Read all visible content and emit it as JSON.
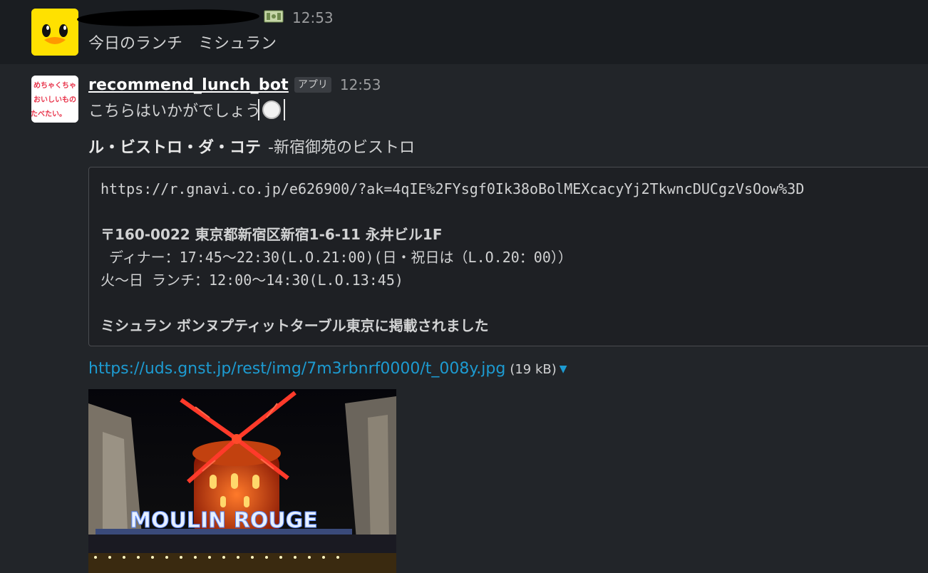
{
  "messages": [
    {
      "time": "12:53",
      "text": "今日のランチ　ミシュラン"
    },
    {
      "sender": "recommend_lunch_bot",
      "badge": "アプリ",
      "time": "12:53",
      "text": "こちらはいかがでしょう",
      "avatar_text": [
        "めちゃくちゃ",
        "おいしいもの",
        "たべたい。"
      ],
      "attachment": {
        "title": "ル・ビストロ・ダ・コテ",
        "subtitle": "-新宿御苑のビストロ",
        "lines": [
          "https://r.gnavi.co.jp/e626900/?ak=4qIE%2FYsgf0Ik38oBolMEXcacyYj2TkwncDUCgzVsOow%3D",
          "",
          "〒160-0022 東京都新宿区新宿1-6-11 永井ビル1F",
          " ディナー：17:45〜22:30(L.O.21:00)(日・祝日は（L.O.20：00））",
          "火〜日 ランチ：12:00〜14:30(L.O.13:45)",
          "",
          "ミシュラン ボンヌプティットターブル東京に掲載されました"
        ]
      },
      "image_link": "https://uds.gnst.jp/rest/img/7m3rbnrf0000/t_008y.jpg",
      "image_size": "(19 kB)",
      "image_sign_text": "MOULIN ROUGE"
    }
  ],
  "icons": {
    "bill": "money-bill-icon",
    "plate": "fork-knife-plate-icon",
    "caret": "caret-down-icon"
  },
  "colors": {
    "background": "#1a1d21",
    "hover_background": "#222529",
    "link": "#1d9bd1"
  }
}
